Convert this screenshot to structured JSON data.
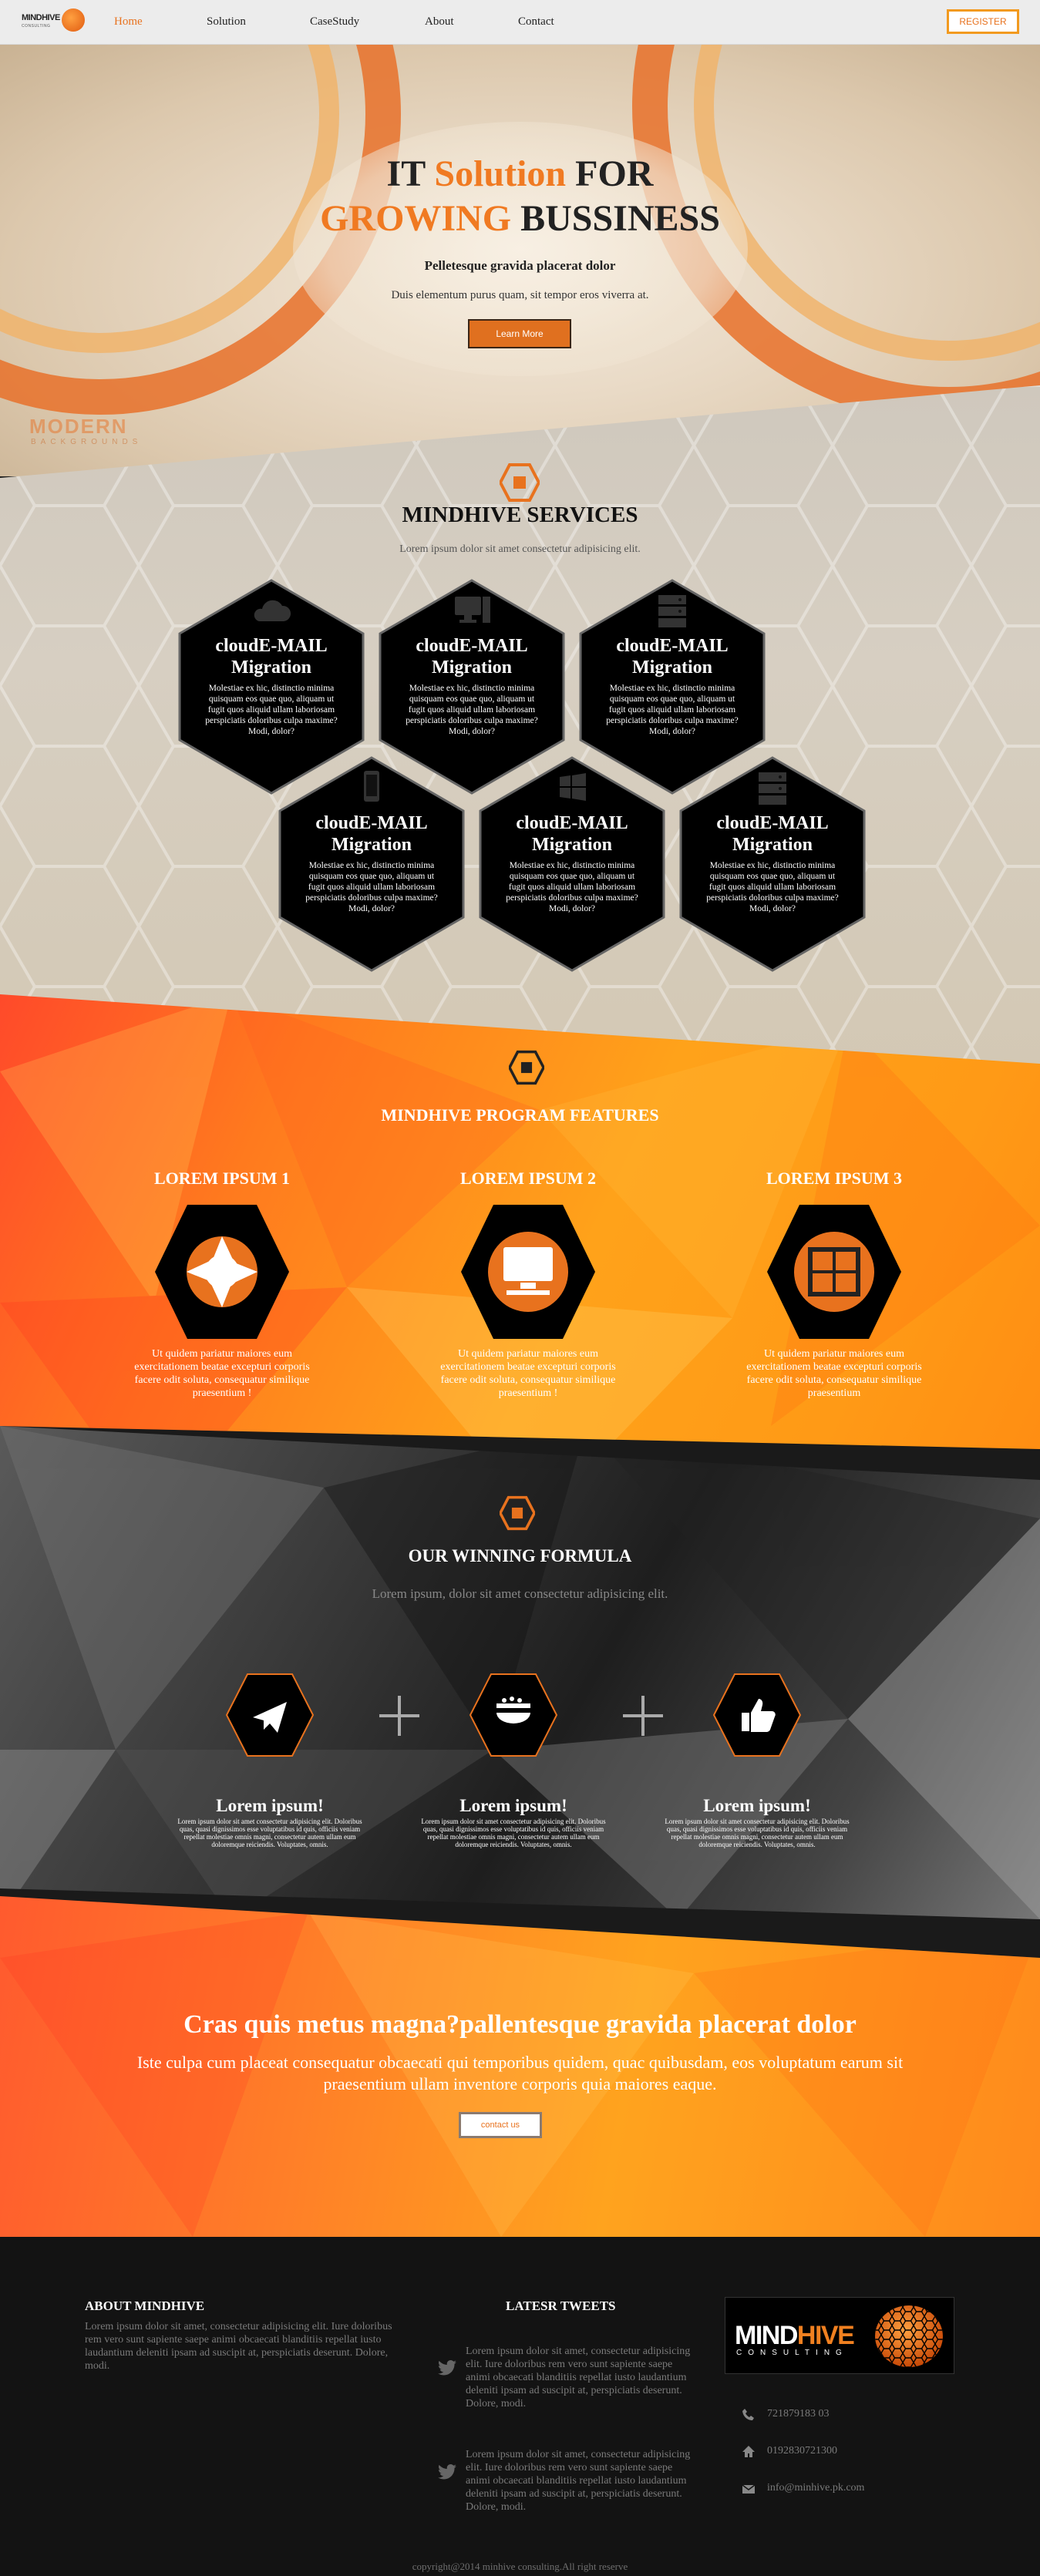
{
  "brand": {
    "logo_text": "MINDHIVE",
    "logo_sub": "CONSULTING"
  },
  "nav": {
    "items": [
      {
        "label": "Home",
        "active": true
      },
      {
        "label": "Solution"
      },
      {
        "label": "CaseStudy"
      },
      {
        "label": "About"
      },
      {
        "label": "Contact"
      }
    ],
    "register_label": "REGISTER"
  },
  "hero": {
    "title_line1_a": "IT ",
    "title_line1_b": "Solution",
    "title_line1_c": " FOR",
    "title_line2_a": "GROWING",
    "title_line2_b": " BUSSINESS",
    "subtitle": "Pelletesque gravida placerat dolor",
    "description": "Duis elementum purus quam, sit tempor eros viverra at.",
    "button_label": "Learn More",
    "watermark": "MODERN",
    "watermark_sub": "BACKGROUNDS"
  },
  "services": {
    "title": "MINDHIVE SERVICES",
    "lead": "Lorem ipsum dolor sit amet consectetur adipisicing elit.",
    "items": [
      {
        "icon": "cloud-icon",
        "title": "cloudE-MAIL Migration",
        "text": "Molestiae ex hic, distinctio minima quisquam eos quae quo, aliquam ut fugit quos aliquid ullam laboriosam perspiciatis doloribus culpa maxime? Modi, dolor?"
      },
      {
        "icon": "desktop-icon",
        "title": "cloudE-MAIL Migration",
        "text": "Molestiae ex hic, distinctio minima quisquam eos quae quo, aliquam ut fugit quos aliquid ullam laboriosam perspiciatis doloribus culpa maxime? Modi, dolor?"
      },
      {
        "icon": "server-icon",
        "title": "cloudE-MAIL Migration",
        "text": "Molestiae ex hic, distinctio minima quisquam eos quae quo, aliquam ut fugit quos aliquid ullam laboriosam perspiciatis doloribus culpa maxime? Modi, dolor?"
      },
      {
        "icon": "mobile-icon",
        "title": "cloudE-MAIL Migration",
        "text": "Molestiae ex hic, distinctio minima quisquam eos quae quo, aliquam ut fugit quos aliquid ullam laboriosam perspiciatis doloribus culpa maxime? Modi, dolor?"
      },
      {
        "icon": "windows-icon",
        "title": "cloudE-MAIL Migration",
        "text": "Molestiae ex hic, distinctio minima quisquam eos quae quo, aliquam ut fugit quos aliquid ullam laboriosam perspiciatis doloribus culpa maxime? Modi, dolor?"
      },
      {
        "icon": "server-icon",
        "title": "cloudE-MAIL Migration",
        "text": "Molestiae ex hic, distinctio minima quisquam eos quae quo, aliquam ut fugit quos aliquid ullam laboriosam perspiciatis doloribus culpa maxime? Modi, dolor?"
      }
    ]
  },
  "features": {
    "title": "MINDHIVE PROGRAM FEATURES",
    "items": [
      {
        "title": "LOREM IPSUM 1",
        "icon": "aperture-icon",
        "text": "Ut quidem pariatur maiores eum exercitationem beatae excepturi corporis facere odit soluta, consequatur similique praesentium !"
      },
      {
        "title": "LOREM IPSUM 2",
        "icon": "computer-icon",
        "text": "Ut quidem pariatur maiores eum exercitationem beatae excepturi corporis facere odit soluta, consequatur similique praesentium !"
      },
      {
        "title": "LOREM IPSUM 3",
        "icon": "grid-icon",
        "text": "Ut quidem pariatur maiores eum exercitationem beatae excepturi corporis facere odit soluta, consequatur similique praesentium"
      }
    ]
  },
  "winning": {
    "title": "OUR WINNING FORMULA",
    "lead": "Lorem ipsum, dolor sit amet consectetur adipisicing elit.",
    "items": [
      {
        "icon": "paper-plane-icon",
        "title": "Lorem ipsum!",
        "text": "Lorem ipsum dolor sit amet consectetur adipisicing elit. Doloribus quas, quasi dignissimos esse voluptatibus id quis, officiis veniam repellat molestiae omnis magni, consectetur autem ullam eum doloremque reiciendis. Voluptates, omnis."
      },
      {
        "icon": "food-bowl-icon",
        "title": "Lorem ipsum!",
        "text": "Lorem ipsum dolor sit amet consectetur adipisicing elit. Doloribus quas, quasi dignissimos esse voluptatibus id quis, officiis veniam repellat molestiae omnis magni, consectetur autem ullam eum doloremque reiciendis. Voluptates, omnis."
      },
      {
        "icon": "thumbs-up-icon",
        "title": "Lorem ipsum!",
        "text": "Lorem ipsum dolor sit amet consectetur adipisicing elit. Doloribus quas, quasi dignissimos esse voluptatibus id quis, officiis veniam repellat molestiae omnis magni, consectetur autem ullam eum doloremque reiciendis. Voluptates, omnis."
      }
    ]
  },
  "cta": {
    "title": "Cras quis metus magna?pallentesque gravida placerat dolor",
    "text": "Iste culpa cum placeat consequatur obcaecati qui temporibus quidem, quac quibusdam, eos voluptatum earum sit praesentium ullam inventore corporis quia maiores eaque.",
    "button_label": "contact us"
  },
  "footer": {
    "about_title": "ABOUT MINDHIVE",
    "about_text": "Lorem ipsum dolor sit amet, consectetur adipisicing elit. Iure doloribus rem vero sunt sapiente saepe animi obcaecati blanditiis repellat iusto laudantium deleniti ipsam ad suscipit at, perspiciatis deserunt. Dolore, modi.",
    "tweets_title": "LATESR TWEETS",
    "tweets": [
      {
        "text": "Lorem ipsum dolor sit amet, consectetur adipisicing elit. Iure doloribus rem vero sunt sapiente saepe animi obcaecati blanditiis repellat iusto laudantium deleniti ipsam ad suscipit at, perspiciatis deserunt. Dolore, modi."
      },
      {
        "text": "Lorem ipsum dolor sit amet, consectetur adipisicing elit. Iure doloribus rem vero sunt sapiente saepe animi obcaecati blanditiis repellat iusto laudantium deleniti ipsam ad suscipit at, perspiciatis deserunt. Dolore, modi."
      }
    ],
    "logo_a": "MIND",
    "logo_b": "HIVE",
    "logo_sub": "CONSULTING",
    "phone": "721879183 03",
    "home_phone": "0192830721300",
    "email": "info@minhive.pk.com",
    "copyright": "copyright@2014 minhive consulting.All right reserve"
  },
  "colors": {
    "accent": "#e8721e",
    "dark": "#131313",
    "hex_fill": "#000000"
  }
}
